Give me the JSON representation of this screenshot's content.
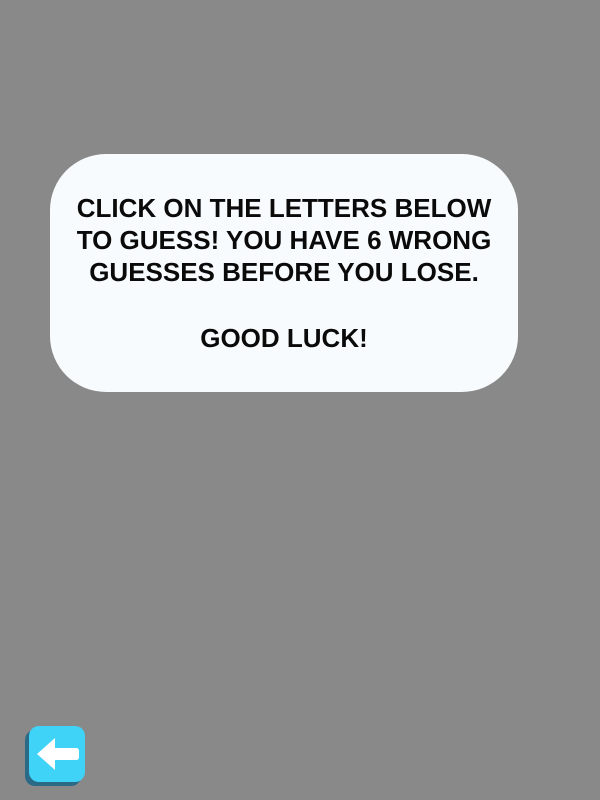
{
  "instructions": {
    "lines": [
      "CLICK ON THE LETTERS BELOW",
      "TO GUESS! YOU HAVE 6 WRONG",
      "GUESSES BEFORE YOU LOSE."
    ],
    "closing": "GOOD LUCK!"
  },
  "back_button": {
    "icon": "arrow-left-icon",
    "color": "#3fd3f8"
  },
  "colors": {
    "background": "#898989",
    "panel": "#f7fbfd",
    "text": "#0a0a0a"
  }
}
